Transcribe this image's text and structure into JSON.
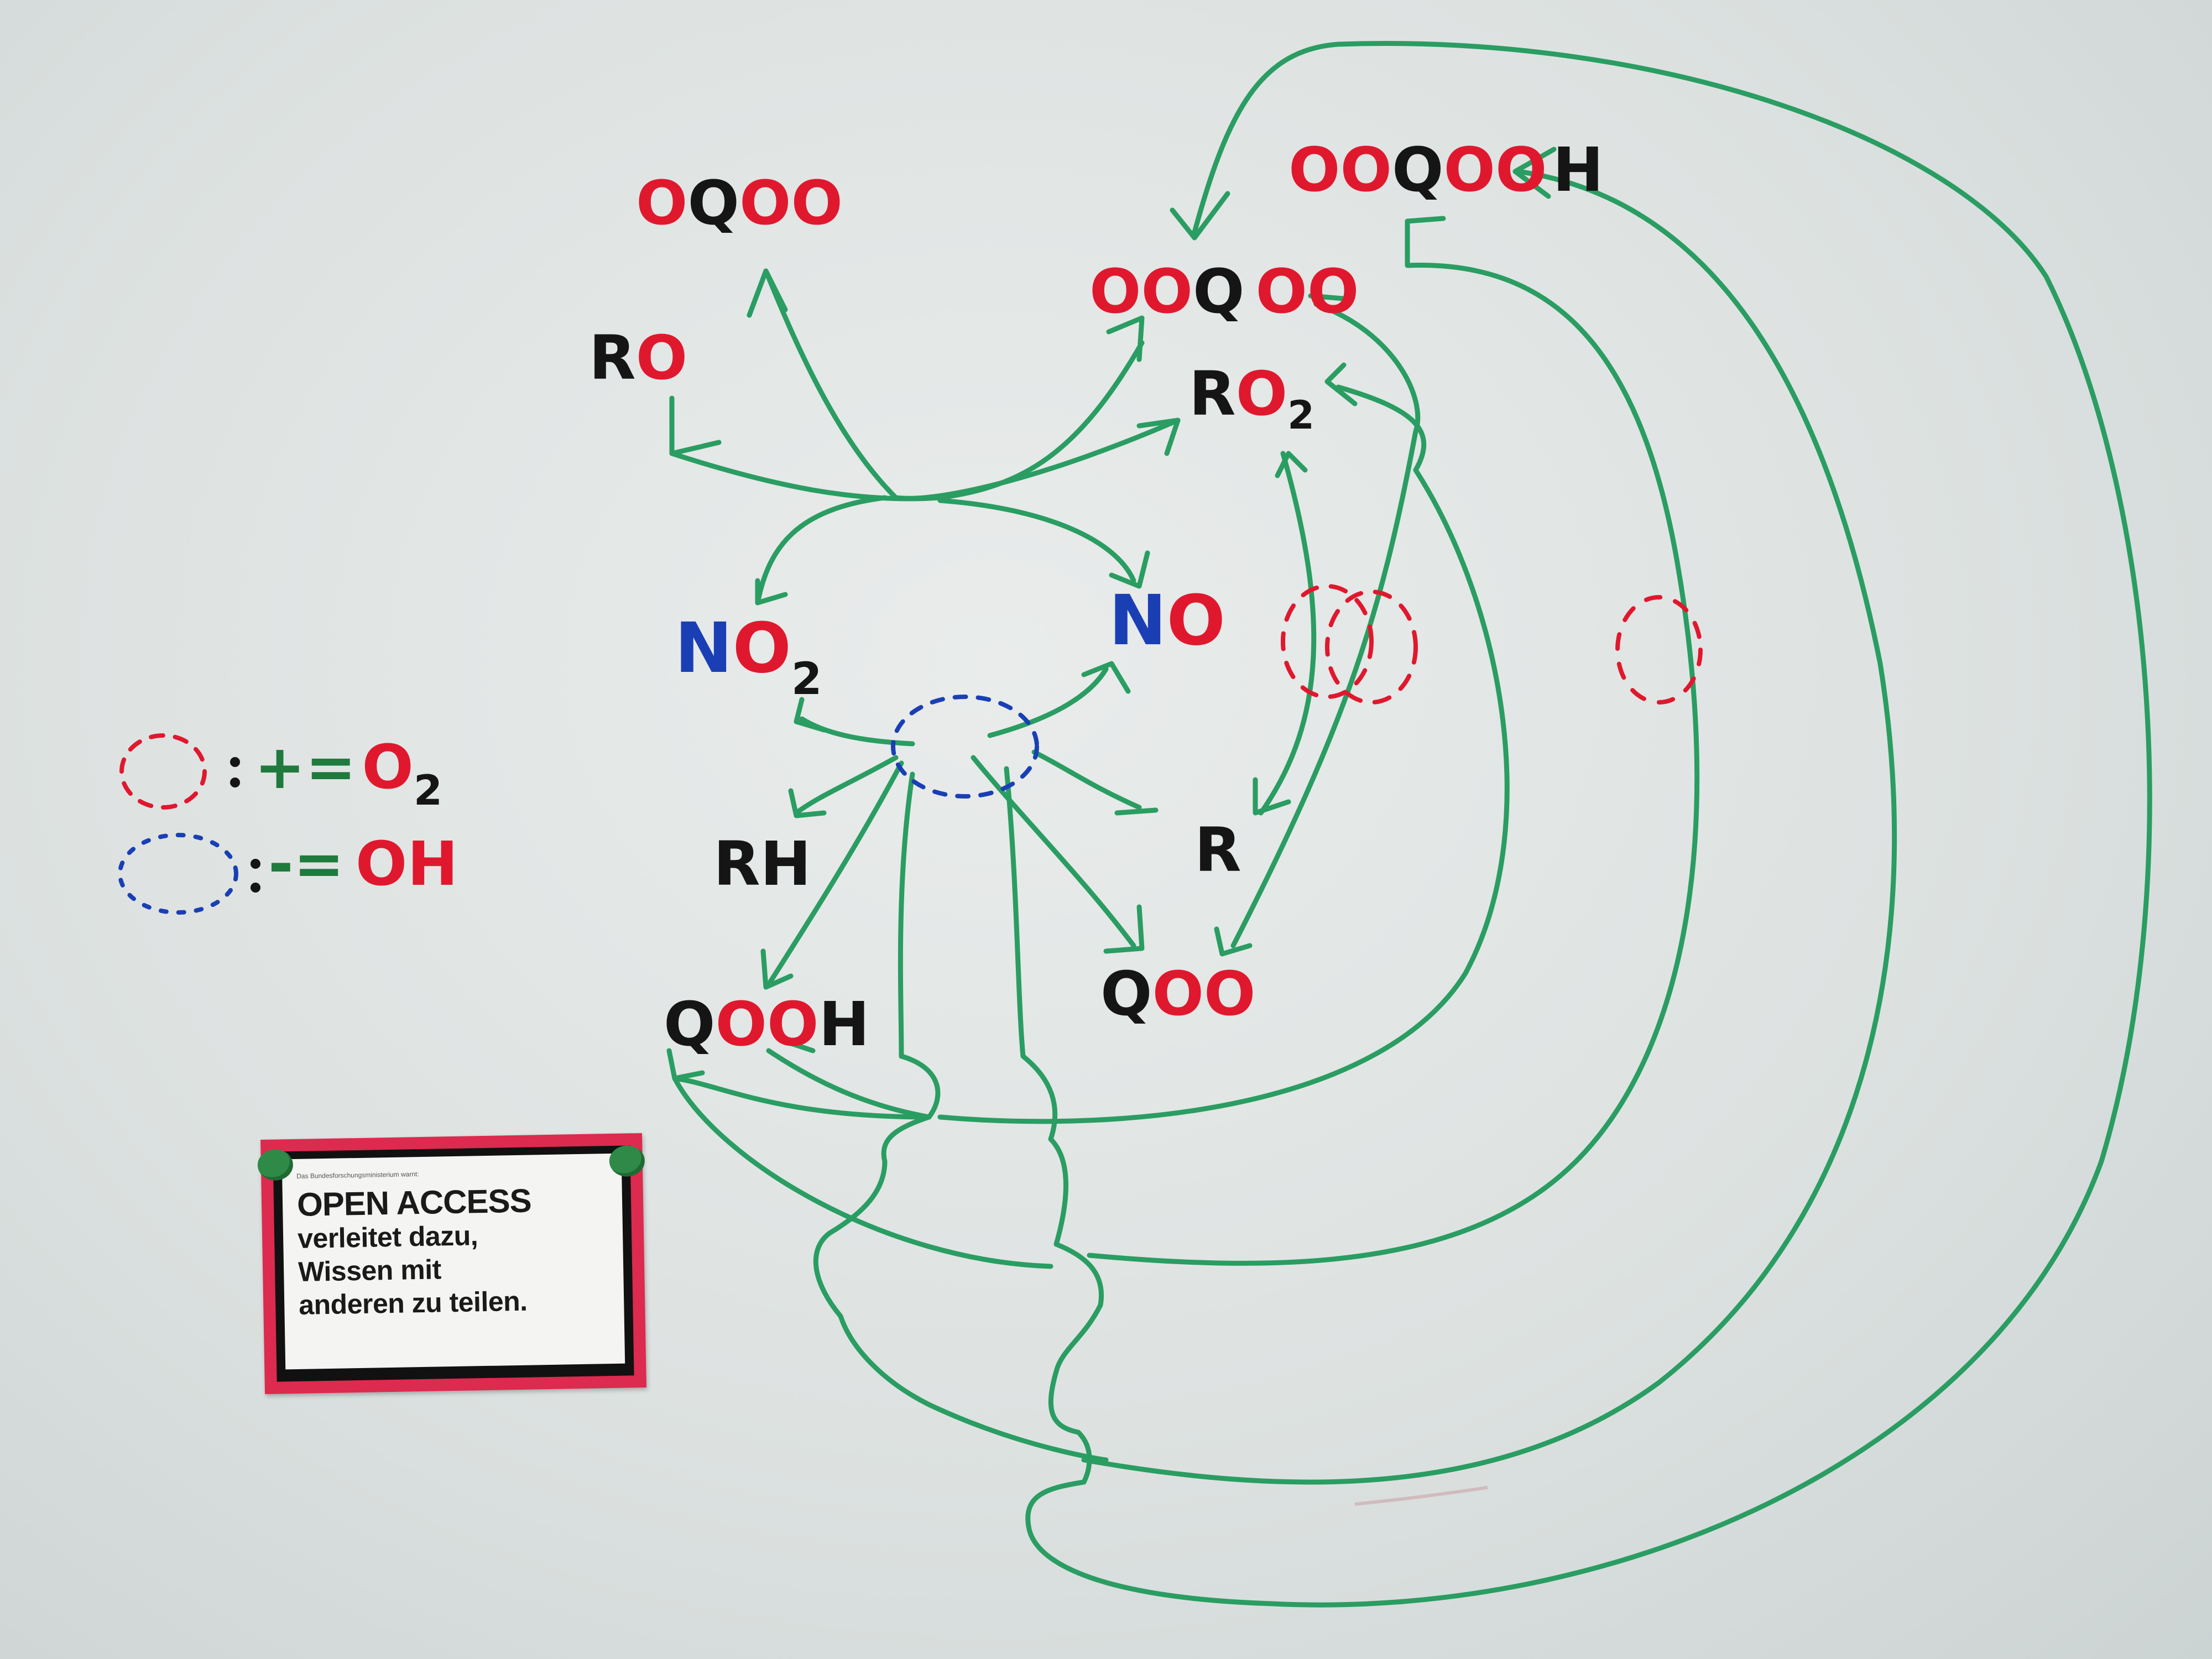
{
  "diagram": {
    "species": {
      "oqoo": [
        "O",
        "Q",
        "OO"
      ],
      "ro": [
        "R",
        "O"
      ],
      "ooqoo": [
        "OO",
        "Q",
        "OO"
      ],
      "ooqooh": [
        "OO",
        "Q",
        "OO",
        "H"
      ],
      "ro2": [
        "R",
        "O",
        "2"
      ],
      "no2": [
        "N",
        "O",
        "2"
      ],
      "no": [
        "N",
        "O"
      ],
      "rh": "RH",
      "r": "R",
      "qooh": [
        "Q",
        "OO",
        "H"
      ],
      "qoo": [
        "Q",
        "OO"
      ]
    },
    "legend": {
      "o2": {
        "sign": "+=",
        "formula": "O",
        "subscript": "2"
      },
      "oh": {
        "sign": "-=",
        "formula": "OH"
      }
    }
  },
  "sign": {
    "small_text": "Das Bundesforschungsministerium warnt:",
    "title": "OPEN ACCESS",
    "line1": "verleitet dazu,",
    "line2": "Wissen mit",
    "line3": "anderen zu teilen."
  },
  "colors": {
    "green": "#2a9d62",
    "red": "#e0182e",
    "blue": "#1a3fb5",
    "black": "#151515"
  }
}
